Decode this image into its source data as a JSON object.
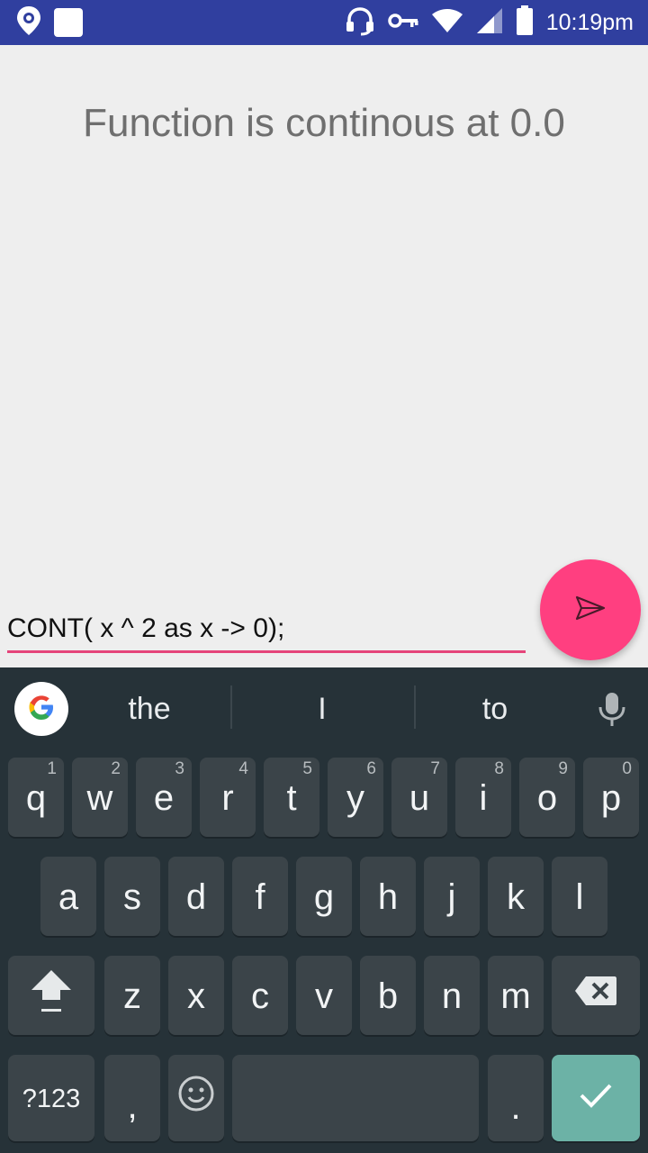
{
  "status_bar": {
    "time": "10:19pm",
    "icons": [
      "location-pin-icon",
      "note-square-icon",
      "headset-icon",
      "key-icon",
      "wifi-icon",
      "cell-signal-icon",
      "battery-icon"
    ]
  },
  "result_text": "Function is continous at 0.0",
  "input": {
    "value": "CONT( x ^ 2 as x -> 0);"
  },
  "fab": {
    "icon": "send-icon",
    "color": "#ff3f80"
  },
  "keyboard": {
    "suggestions": [
      "the",
      "I",
      "to"
    ],
    "row1": [
      {
        "label": "q",
        "hint": "1"
      },
      {
        "label": "w",
        "hint": "2"
      },
      {
        "label": "e",
        "hint": "3"
      },
      {
        "label": "r",
        "hint": "4"
      },
      {
        "label": "t",
        "hint": "5"
      },
      {
        "label": "y",
        "hint": "6"
      },
      {
        "label": "u",
        "hint": "7"
      },
      {
        "label": "i",
        "hint": "8"
      },
      {
        "label": "o",
        "hint": "9"
      },
      {
        "label": "p",
        "hint": "0"
      }
    ],
    "row2": [
      "a",
      "s",
      "d",
      "f",
      "g",
      "h",
      "j",
      "k",
      "l"
    ],
    "row3": [
      "z",
      "x",
      "c",
      "v",
      "b",
      "n",
      "m"
    ],
    "symbols_label": "?123",
    "comma_label": ",",
    "period_label": "."
  },
  "colors": {
    "status_bar": "#303f9f",
    "accent": "#e5457a",
    "keyboard_bg": "#263238",
    "key_bg": "#3b4449",
    "enter_key": "#6cb2a6"
  }
}
